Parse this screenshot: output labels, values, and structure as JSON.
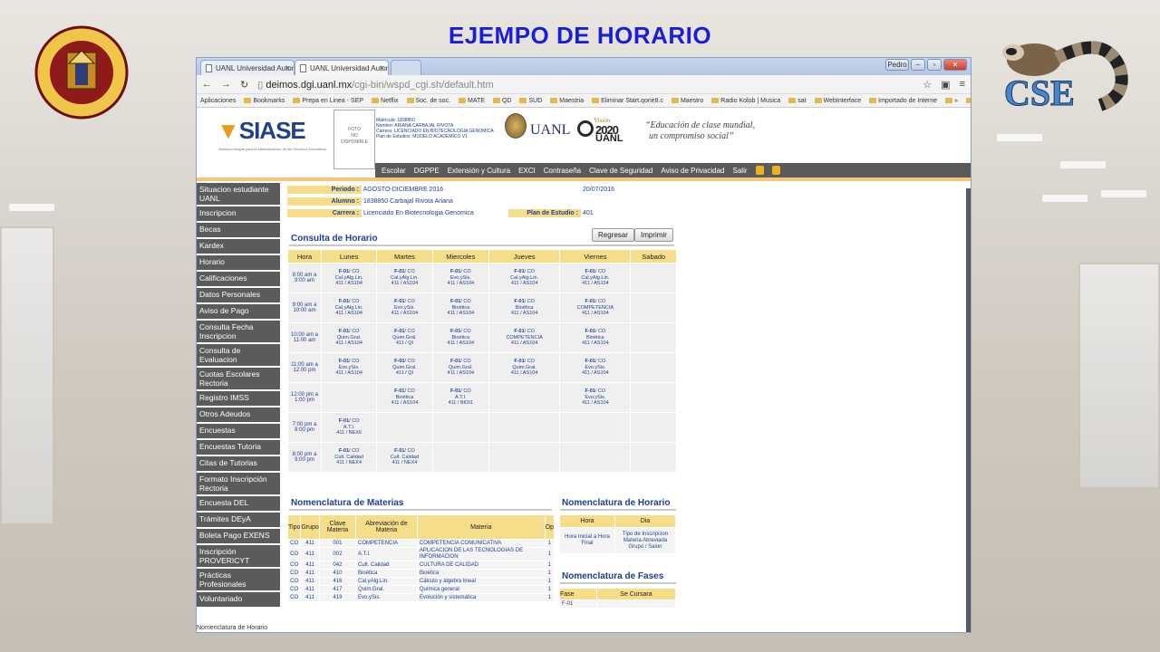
{
  "slide": {
    "title": "EJEMPO DE HORARIO"
  },
  "logos": {
    "seal_text": "FACULTAD DE CIENCIAS BIOLÓGICAS UNIVERSIDAD AUTÓNOMA DE NUEVO LEÓN",
    "seal_motto": "SCIENTIA NATURAM NOSCIT",
    "right_logo": "CSE"
  },
  "browser": {
    "tabs": [
      "UANL Universidad Autono",
      "UANL Universidad Autono"
    ],
    "window_user": "Pedro",
    "url_host": "deimos.dgi.uanl.mx",
    "url_path": "/cgi-bin/wspd_cgi.sh/default.htm",
    "bookmarks": [
      "Aplicaciones",
      "Bookmarks",
      "Prepa en Linea - SEP",
      "Netflix",
      "Soc. de soc.",
      "MATE",
      "QD",
      "SUD",
      "Maestria",
      "Eliminar Start.qone8.c",
      "Maestro",
      "Radio Kolob | Musica",
      "sat",
      "WebInterface",
      "Importado de Interne",
      "»",
      "Otros marcadores"
    ]
  },
  "header": {
    "siase": "SIASE",
    "siase_sub": "Sistema Integral para la Administración de los Servicios Educativos",
    "foto": [
      "FOTO",
      "NO",
      "DISPONIBLE"
    ],
    "student_lines": [
      "Matrícula: 1838850",
      "Nombre: ARIANA CARBAJAL RIVOTA",
      "Carrera: LICENCIADO EN BIOTECNOLOGIA GENOMICA",
      "Plan de Estudios: MODELO ACADEMICO V1"
    ],
    "uanl": "UANL",
    "vision_label": "Visión",
    "vision_year": "2020",
    "vision_uanl": "UANL",
    "quote_line1": "“Educación de clase mundial,",
    "quote_line2": "un compromiso social”",
    "menu": [
      "Escolar",
      "DGPPE",
      "Extensión y Cultura",
      "EXCI",
      "Contraseña",
      "Clave de Seguridad",
      "Aviso de Privacidad",
      "Salir"
    ]
  },
  "sidebar": [
    "Situacion estudiante UANL",
    "Inscripcion",
    "Becas",
    "Kardex",
    "Horario",
    "Calificaciones",
    "Datos Personales",
    "Aviso de Pago",
    "Consulta Fecha Inscripcion",
    "Consulta de Evaluacion",
    "Cuotas Escolares Rectoria",
    "Registro IMSS",
    "Otros Adeudos",
    "Encuestas",
    "Encuestas Tutoria",
    "Citas de Tutorias",
    "Formato Inscripción Rectoria",
    "Encuesta DEL",
    "Trámites DEyA",
    "Boleta Pago EXENS",
    "Inscripción PROVERICYT",
    "Prácticas Profesionales",
    "Voluntariado"
  ],
  "sidebar_footer": "Nomenclatura de Horario",
  "info": {
    "periodo_label": "Periodo :",
    "periodo_value": "AGOSTO-DICIEMBRE 2016",
    "fecha": "20/07/2016",
    "alumno_label": "Alumno :",
    "alumno_value": "1838850 Carbajal Rivota Ariana",
    "carrera_label": "Carrera :",
    "carrera_value": "Licenciado En Biotecnologia Genomica",
    "plan_label": "Plan de Estudio :",
    "plan_value": "401"
  },
  "consulta": {
    "title": "Consulta de Horario",
    "regresar": "Regresar",
    "imprimir": "Imprimir"
  },
  "schedule": {
    "headers": [
      "Hora",
      "Lunes",
      "Martes",
      "Miercoles",
      "Jueves",
      "Viernes",
      "Sabado"
    ],
    "rows": [
      {
        "hora": [
          "8:00 am a",
          "9:00 am"
        ],
        "cells": [
          [
            "F-01",
            "/ CO",
            "Cal.yAlg.Lin.",
            "411 / AS104"
          ],
          [
            "F-01",
            "/ CO",
            "Cal.yAlg.Lin.",
            "411 / AS104"
          ],
          [
            "F-01",
            "/ CO",
            "Evo.ySis.",
            "411 / AS104"
          ],
          [
            "F-01",
            "/ CO",
            "Cal.yAlg.Lin.",
            "411 / AS104"
          ],
          [
            "F-01",
            "/ CO",
            "Cal.yAlg.Lin.",
            "411 / AS104"
          ],
          null
        ]
      },
      {
        "hora": [
          "9:00 am a",
          "10:00 am"
        ],
        "cells": [
          [
            "F-01",
            "/ CO",
            "Cal.yAlg.Lin.",
            "411 / AS104"
          ],
          [
            "F-01",
            "/ CO",
            "Evo.ySis.",
            "411 / AS104"
          ],
          [
            "F-01",
            "/ CO",
            "Bioética",
            "411 / AS104"
          ],
          [
            "F-01",
            "/ CO",
            "Bioética",
            "411 / AS104"
          ],
          [
            "F-01",
            "/ CO",
            "COMPETENCIA",
            "411 / AS104"
          ],
          null
        ]
      },
      {
        "hora": [
          "10:00 am a",
          "11:00 am"
        ],
        "cells": [
          [
            "F-01",
            "/ CO",
            "Quim.Gral.",
            "411 / AS104"
          ],
          [
            "F-01",
            "/ CO",
            "Quim.Gral.",
            "411 / QI"
          ],
          [
            "F-01",
            "/ CO",
            "Bioética",
            "411 / AS104"
          ],
          [
            "F-01",
            "/ CO",
            "COMPETENCIA",
            "411 / AS104"
          ],
          [
            "F-01",
            "/ CO",
            "Bioética",
            "411 / AS104"
          ],
          null
        ]
      },
      {
        "hora": [
          "11:00 am a",
          "12:00 pm"
        ],
        "cells": [
          [
            "F-01",
            "/ CO",
            "Evo.ySis.",
            "411 / AS104"
          ],
          [
            "F-01",
            "/ CO",
            "Quim.Gral.",
            "411 / QI"
          ],
          [
            "F-01",
            "/ CO",
            "Quim.Gral.",
            "411 / AS104"
          ],
          [
            "F-01",
            "/ CO",
            "Quim.Gral.",
            "411 / AS104"
          ],
          [
            "F-01",
            "/ CO",
            "Evo.ySis.",
            "411 / AS104"
          ],
          null
        ]
      },
      {
        "hora": [
          "12:00 pm a",
          "1:00 pm"
        ],
        "cells": [
          null,
          [
            "F-01",
            "/ CO",
            "Bioética",
            "411 / AS104"
          ],
          [
            "F-01",
            "/ CO",
            "A.T.I.",
            "411 / BIOI1"
          ],
          null,
          [
            "F-01",
            "/ CO",
            "Evo.ySis.",
            "411 / AS104"
          ],
          null
        ]
      },
      {
        "hora": [
          "7:00 pm a",
          "8:00 pm"
        ],
        "cells": [
          [
            "F-01",
            "/ CO",
            "A.T.I.",
            "411 / NEX6"
          ],
          null,
          null,
          null,
          null,
          null
        ]
      },
      {
        "hora": [
          "8:00 pm a",
          "9:00 pm"
        ],
        "cells": [
          [
            "F-01",
            "/ CO",
            "Cult. Calidad",
            "411 / NEX4"
          ],
          [
            "F-01",
            "/ CO",
            "Cult. Calidad",
            "411 / NEX4"
          ],
          null,
          null,
          null,
          null
        ]
      }
    ]
  },
  "nom_materias": {
    "title": "Nomenclatura de Materias",
    "headers": [
      "Tipo",
      "Grupo",
      "Clave Materia",
      "Abreviación de Materia",
      "Materia",
      "Op"
    ],
    "rows": [
      [
        "CO",
        "411",
        "001",
        "COMPETENCIA",
        "COMPETENCIA COMUNICATIVA",
        "1"
      ],
      [
        "CO",
        "411",
        "002",
        "A.T.I.",
        "APLICACION DE LAS TECNOLOGIAS DE INFORMACION",
        "1"
      ],
      [
        "CO",
        "411",
        "042",
        "Cult. Calidad",
        "CULTURA DE CALIDAD",
        "1"
      ],
      [
        "CO",
        "411",
        "410",
        "Bioética",
        "Bioética",
        "1"
      ],
      [
        "CO",
        "411",
        "416",
        "Cal.yAlg.Lin.",
        "Cálculo y álgebra lineal",
        "1"
      ],
      [
        "CO",
        "411",
        "417",
        "Quim.Gral.",
        "Química general",
        "1"
      ],
      [
        "CO",
        "411",
        "419",
        "Evo.ySis.",
        "Evolución y sistemática",
        "1"
      ]
    ]
  },
  "nom_horario": {
    "title": "Nomenclatura de Horario",
    "headers": [
      "Hora",
      "Dia"
    ],
    "hora_desc": "Hora Inicial a Hora Final",
    "dia_desc": "Tipo de Inscripcion Materia Abreviada Grupo / Salon"
  },
  "nom_fases": {
    "title": "Nomenclatura de Fases",
    "headers": [
      "Fase",
      "Se Cursara"
    ],
    "rows": [
      [
        "F-01",
        ""
      ]
    ]
  }
}
